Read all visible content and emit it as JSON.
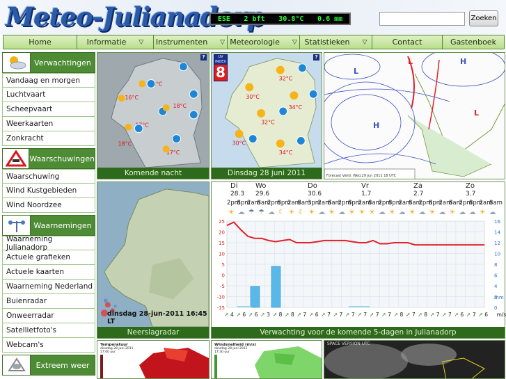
{
  "header": {
    "logo": "Meteo-Julianadorp",
    "ticker": {
      "wind_dir": "ESE",
      "wind_force": "2 bft",
      "temperature": "30.8°C",
      "rain": "0.6 mm"
    },
    "search_placeholder": "",
    "search_button": "Zoeken"
  },
  "nav": [
    {
      "label": "Home",
      "dropdown": false
    },
    {
      "label": "Informatie",
      "dropdown": true
    },
    {
      "label": "Instrumenten",
      "dropdown": true
    },
    {
      "label": "Meteorologie",
      "dropdown": true
    },
    {
      "label": "Statistieken",
      "dropdown": true
    },
    {
      "label": "Contact",
      "dropdown": false
    },
    {
      "label": "Gastenboek",
      "dropdown": false
    }
  ],
  "sidebar": {
    "sections": [
      {
        "title": "Verwachtingen",
        "icon": "sun-cloud-icon",
        "items": [
          "Vandaag en morgen",
          "Luchtvaart",
          "Scheepvaart",
          "Weerkaarten",
          "Zonkracht"
        ]
      },
      {
        "title": "Waarschuwingen",
        "icon": "warning-sign-icon",
        "items": [
          "Waarschuwing",
          "Wind Kustgebieden",
          "Wind Noordzee"
        ]
      },
      {
        "title": "Waarnemingen",
        "icon": "anemometer-icon",
        "items": [
          "Waarneming Julianadorp",
          "Actuele grafieken",
          "Actuele kaarten",
          "Waarneming Nederland",
          "Buienradar",
          "Onweerradar",
          "Satellietfoto's",
          "Webcam's"
        ]
      },
      {
        "title": "Extreem weer",
        "icon": "storm-icon",
        "items": []
      }
    ]
  },
  "tiles": {
    "tonight": {
      "caption": "Komende nacht",
      "temps": [
        "18°C",
        "16°C",
        "18°C",
        "17°C",
        "18°C",
        "17°C",
        "18°C"
      ],
      "winds": [
        "3",
        "3",
        "3",
        "3",
        "3",
        "3",
        "3",
        "3"
      ]
    },
    "today": {
      "caption": "Dinsdag 28 juni 2011",
      "uv_label": "UV INDEX",
      "uv_value": "8",
      "temps": [
        "32°C",
        "30°C",
        "34°C",
        "32°C",
        "30°C",
        "34°C"
      ],
      "winds": [
        "4",
        "4",
        "4",
        "2",
        "3",
        "3"
      ]
    },
    "pressure": {
      "footer": "Forecast Valid: Wed,29 Jun 2011 18 UTC",
      "highs": [
        "H",
        "H"
      ],
      "lows": [
        "L",
        "L",
        "L"
      ]
    },
    "radar": {
      "caption": "Neerslagradar",
      "timestamp": "dinsdag 28-jun-2011 16:45 LT"
    },
    "temperature_map": {
      "title": "Temperatuur",
      "subtitle": "dinsdag 28 juni 2011",
      "time": "17:00 uur"
    },
    "wind_map": {
      "title": "Windsnelheid (m/s)",
      "subtitle": "dinsdag 28 juni 2011",
      "time": "17:30 uur"
    },
    "satellite": {
      "label": "SPACE VERSION UTC"
    }
  },
  "forecast": {
    "caption": "Verwachting voor de komende 5-dagen in Julianadorp",
    "days": [
      {
        "label": "Di",
        "temp": "28.3"
      },
      {
        "label": "Wo",
        "temp": "29.6"
      },
      {
        "label": "Do",
        "temp": "30.6"
      },
      {
        "label": "Vr",
        "temp": "1.7"
      },
      {
        "label": "Za",
        "temp": "2.7"
      },
      {
        "label": "Zo",
        "temp": "3.7"
      }
    ],
    "times": [
      "2pm",
      "8pm",
      "2am",
      "8am",
      "2pm",
      "8pm",
      "2am",
      "8am",
      "3pm",
      "2am",
      "8am",
      "2pm",
      "8pm",
      "2am",
      "8am",
      "2pm",
      "8pm",
      "2am",
      "8am",
      "2pm",
      "8pm",
      "2am",
      "8am",
      "2pm",
      "8pm",
      "2am",
      "8am"
    ],
    "wind_labels": [
      "4",
      "6",
      "6",
      "3",
      "8",
      "8",
      "7",
      "6",
      "7",
      "7",
      "7",
      "7",
      "7",
      "7",
      "8",
      "7",
      "8",
      "7",
      "7",
      "6",
      "7",
      "6",
      "m/sec"
    ]
  },
  "chart_data": {
    "type": "line",
    "title": "",
    "ylim_left": [
      -15,
      25
    ],
    "ylim_right": [
      0,
      16
    ],
    "ylabel_right_unit": "mm",
    "series": [
      {
        "values": [
          23,
          24.5,
          21,
          18,
          17,
          17,
          16,
          15.5,
          16,
          16.5,
          15,
          15,
          15,
          15.5,
          16,
          16,
          16,
          16,
          15.5,
          15,
          15,
          16,
          14.5,
          14.5,
          15,
          15,
          15,
          14,
          14,
          14,
          14,
          14,
          14,
          14,
          14,
          14,
          14,
          14
        ],
        "axis": "left"
      }
    ],
    "bars": [
      {
        "index": 4,
        "value": 3.9,
        "axis": "right"
      },
      {
        "index": 7,
        "value": 7.6,
        "axis": "right"
      }
    ]
  },
  "colors": {
    "nav_green": "#b9de8a",
    "side_green": "#4d8c34",
    "caption_green": "#2d6a1b",
    "line_red": "#e0202a",
    "bar_blue": "#5ab8e8"
  }
}
